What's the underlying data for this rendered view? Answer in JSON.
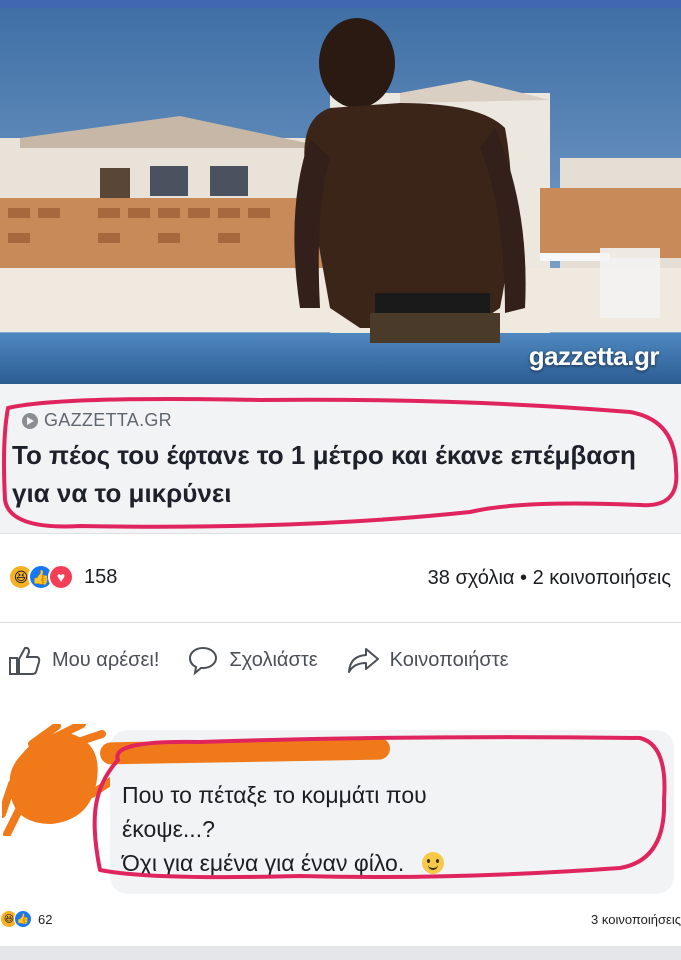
{
  "post": {
    "watermark": "gazzetta.gr",
    "link_source": "GAZZETTA.GR",
    "headline": "Το πέος του έφτανε το 1 μέτρο και έκανε επέμβαση για να το μικρύνει",
    "reactions": [
      "haha",
      "like",
      "love"
    ],
    "reaction_count": "158",
    "stats": "38 σχόλια • 2 κοινοποιήσεις",
    "actions": {
      "like": "Μου αρέσει!",
      "comment": "Σχολιάστε",
      "share": "Κοινοποιήστε"
    }
  },
  "comment": {
    "line1": "Που το πέταξε το κομμάτι που",
    "line2": "έκοψε...?",
    "line3": "Όχι για εμένα για έναν φίλο.",
    "reaction_count": "62",
    "shares": "3 κοινοποιήσεις"
  },
  "colors": {
    "facebook_blue": "#4267b2",
    "red_marker": "#e0245e",
    "orange_scribble": "#f07a1a"
  }
}
